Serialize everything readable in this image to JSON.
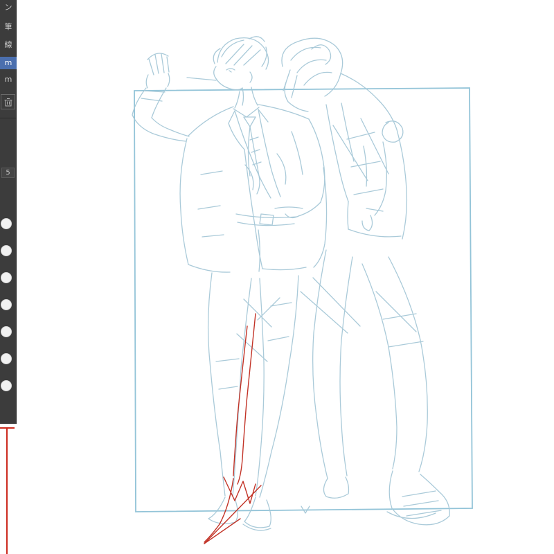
{
  "window": {
    "bg": "#ffffff"
  },
  "sidebar": {
    "bg": "#3c3c3c",
    "selected_bg": "#4b6fae",
    "items": [
      {
        "label": "ン",
        "selected": false
      },
      {
        "label": "筆",
        "selected": false
      },
      {
        "label": "線",
        "selected": false
      },
      {
        "label": "m",
        "selected": true
      },
      {
        "label": "m",
        "selected": false
      }
    ],
    "spinner_value": "5",
    "brush_dot_count": 7
  },
  "canvas": {
    "bg": "#ffffff",
    "sketch_color": "#a6c8d7",
    "frame_color": "#93c4d8",
    "correction_color": "#c23327",
    "panel_accent_color": "#cc2a1e"
  }
}
